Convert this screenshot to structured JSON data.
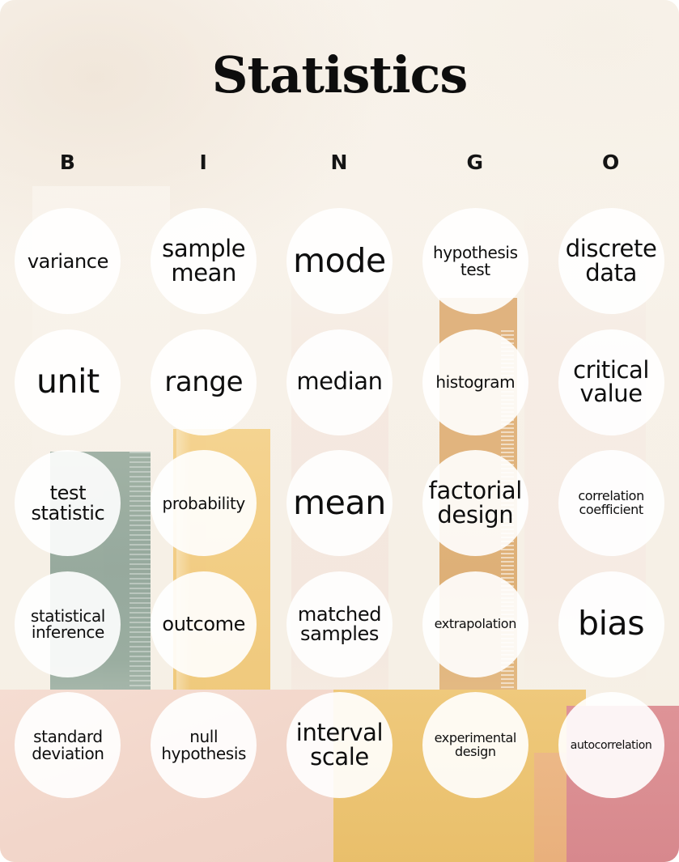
{
  "card": {
    "title": "Statistics",
    "background_color": "#f8f3ec",
    "headers": [
      "B",
      "I",
      "N",
      "G",
      "O"
    ]
  },
  "palette": {
    "background": "#f8f3ec",
    "text": "#0e0e0e",
    "bubble": "#ffffff",
    "band_teal": "#93a89b",
    "band_yellow": "#f2cb7e",
    "band_orange": "#e0b179",
    "block_blush": "#f2d6ca",
    "block_gold": "#ecc473",
    "block_rose": "#da8d91"
  },
  "grid": {
    "columns": 5,
    "rows": 5,
    "cells": [
      {
        "col": "B",
        "row": 1,
        "text": "variance",
        "size": "md"
      },
      {
        "col": "I",
        "row": 1,
        "text": "sample\nmean",
        "size": "lg"
      },
      {
        "col": "N",
        "row": 1,
        "text": "mode",
        "size": "xxl"
      },
      {
        "col": "G",
        "row": 1,
        "text": "hypothesis\ntest",
        "size": "sm"
      },
      {
        "col": "O",
        "row": 1,
        "text": "discrete\ndata",
        "size": "lg"
      },
      {
        "col": "B",
        "row": 2,
        "text": "unit",
        "size": "xxl"
      },
      {
        "col": "I",
        "row": 2,
        "text": "range",
        "size": "xl"
      },
      {
        "col": "N",
        "row": 2,
        "text": "median",
        "size": "lg"
      },
      {
        "col": "G",
        "row": 2,
        "text": "histogram",
        "size": "sm"
      },
      {
        "col": "O",
        "row": 2,
        "text": "critical\nvalue",
        "size": "lg"
      },
      {
        "col": "B",
        "row": 3,
        "text": "test\nstatistic",
        "size": "md"
      },
      {
        "col": "I",
        "row": 3,
        "text": "probability",
        "size": "sm"
      },
      {
        "col": "N",
        "row": 3,
        "text": "mean",
        "size": "xxl"
      },
      {
        "col": "G",
        "row": 3,
        "text": "factorial\ndesign",
        "size": "lg"
      },
      {
        "col": "O",
        "row": 3,
        "text": "correlation\ncoefficient",
        "size": "xs"
      },
      {
        "col": "B",
        "row": 4,
        "text": "statistical\ninference",
        "size": "sm"
      },
      {
        "col": "I",
        "row": 4,
        "text": "outcome",
        "size": "md"
      },
      {
        "col": "N",
        "row": 4,
        "text": "matched\nsamples",
        "size": "md"
      },
      {
        "col": "G",
        "row": 4,
        "text": "extrapolation",
        "size": "xs"
      },
      {
        "col": "O",
        "row": 4,
        "text": "bias",
        "size": "xxl"
      },
      {
        "col": "B",
        "row": 5,
        "text": "standard\ndeviation",
        "size": "sm"
      },
      {
        "col": "I",
        "row": 5,
        "text": "null\nhypothesis",
        "size": "sm"
      },
      {
        "col": "N",
        "row": 5,
        "text": "interval\nscale",
        "size": "lg"
      },
      {
        "col": "G",
        "row": 5,
        "text": "experimental\ndesign",
        "size": "xs"
      },
      {
        "col": "O",
        "row": 5,
        "text": "autocorrelation",
        "size": "xxs"
      }
    ]
  }
}
